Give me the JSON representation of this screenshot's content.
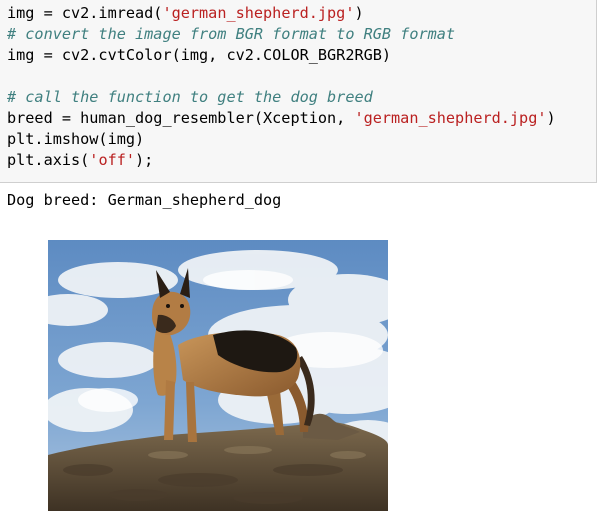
{
  "code_cell": {
    "lines": [
      {
        "segments": [
          {
            "t": "img = cv2.imread(",
            "c": "plain"
          },
          {
            "t": "'german_shepherd.jpg'",
            "c": "str"
          },
          {
            "t": ")",
            "c": "plain"
          }
        ]
      },
      {
        "segments": [
          {
            "t": "# convert the image from BGR format to RGB format",
            "c": "comment"
          }
        ]
      },
      {
        "segments": [
          {
            "t": "img = cv2.cvtColor(img, cv2.COLOR_BGR2RGB)",
            "c": "plain"
          }
        ]
      },
      {
        "segments": []
      },
      {
        "segments": [
          {
            "t": "# call the function to get the dog breed",
            "c": "comment"
          }
        ]
      },
      {
        "segments": [
          {
            "t": "breed = human_dog_resembler(Xception, ",
            "c": "plain"
          },
          {
            "t": "'german_shepherd.jpg'",
            "c": "str"
          },
          {
            "t": ")",
            "c": "plain"
          }
        ]
      },
      {
        "segments": [
          {
            "t": "plt.imshow(img)",
            "c": "plain"
          }
        ]
      },
      {
        "segments": [
          {
            "t": "plt.axis(",
            "c": "plain"
          },
          {
            "t": "'off'",
            "c": "str"
          },
          {
            "t": ");",
            "c": "plain"
          }
        ]
      }
    ]
  },
  "output": {
    "stream_text": "Dog breed: German_shepherd_dog"
  },
  "colors": {
    "cell_background": "#f7f7f7",
    "cell_border": "#cfcfcf",
    "comment": "#408080",
    "string": "#ba2121",
    "sky": "#6c94c6",
    "cloud": "#ecf0f4",
    "ground": "#5a4a36"
  }
}
